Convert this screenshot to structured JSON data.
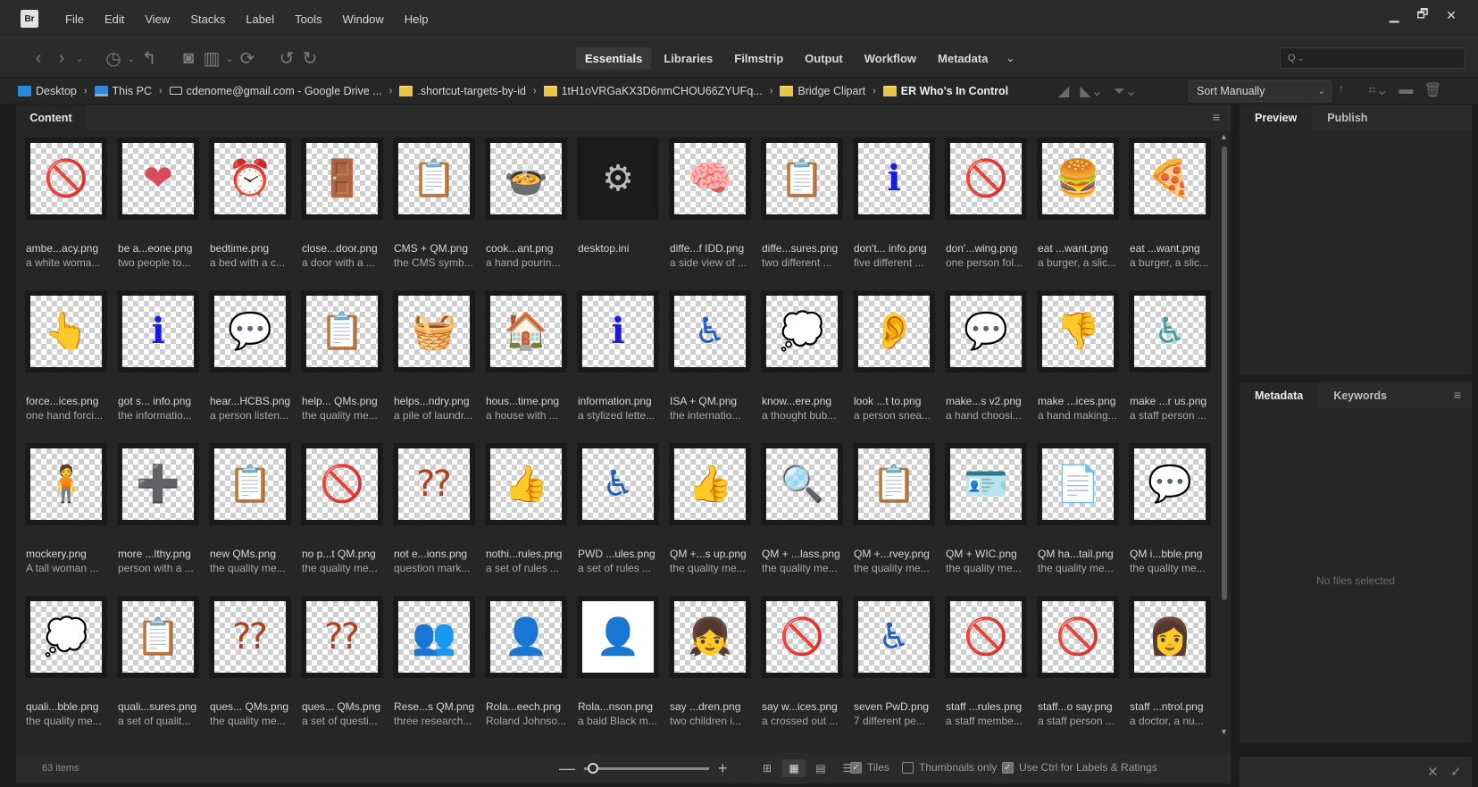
{
  "app": {
    "logo": "Br"
  },
  "menu": [
    "File",
    "Edit",
    "View",
    "Stacks",
    "Label",
    "Tools",
    "Window",
    "Help"
  ],
  "window_controls": {
    "minimize": "▁",
    "restore": "🗗",
    "close": "✕"
  },
  "workspaces": [
    {
      "label": "Essentials",
      "active": true
    },
    {
      "label": "Libraries",
      "active": false
    },
    {
      "label": "Filmstrip",
      "active": false
    },
    {
      "label": "Output",
      "active": false
    },
    {
      "label": "Workflow",
      "active": false
    },
    {
      "label": "Metadata",
      "active": false
    }
  ],
  "search": {
    "placeholder": "Q"
  },
  "breadcrumbs": [
    {
      "label": "Desktop",
      "icon": "desktop-icon"
    },
    {
      "label": "This PC",
      "icon": "computer-icon"
    },
    {
      "label": "cdenome@gmail.com - Google Drive ...",
      "icon": "drive-icon"
    },
    {
      "label": ".shortcut-targets-by-id",
      "icon": "folder-icon"
    },
    {
      "label": "1tH1oVRGaKX3D6nmCHOU66ZYUFq...",
      "icon": "folder-icon"
    },
    {
      "label": "Bridge Clipart",
      "icon": "folder-icon"
    },
    {
      "label": "ER Who's In Control",
      "icon": "folder-icon"
    }
  ],
  "sort": {
    "label": "Sort Manually"
  },
  "content_panel": {
    "tab": "Content",
    "item_count": "63 items"
  },
  "files": [
    {
      "name": "ambe...acy.png",
      "desc": "a white woma...",
      "glyph": "🚫",
      "color": "#e0303a"
    },
    {
      "name": "be a...eone.png",
      "desc": "two people to...",
      "glyph": "❤",
      "color": "#d94a5a"
    },
    {
      "name": "bedtime.png",
      "desc": "a bed with a c...",
      "glyph": "⏰",
      "color": "#7a4aa0"
    },
    {
      "name": "close...door.png",
      "desc": "a door with a ...",
      "glyph": "🚪",
      "color": "#7aa0c0"
    },
    {
      "name": "CMS + QM.png",
      "desc": "the CMS symb...",
      "glyph": "📋",
      "color": "#333"
    },
    {
      "name": "cook...ant.png",
      "desc": "a hand pourin...",
      "glyph": "🍲",
      "color": "#c0392b"
    },
    {
      "name": "desktop.ini",
      "desc": "",
      "glyph": "⚙",
      "color": "#bbb",
      "kind": "doc"
    },
    {
      "name": "diffe...f IDD.png",
      "desc": "a side view of ...",
      "glyph": "🧠",
      "color": "#e8a0b0"
    },
    {
      "name": "diffe...sures.png",
      "desc": "two different ...",
      "glyph": "📋",
      "color": "#333"
    },
    {
      "name": "don't... info.png",
      "desc": "five different ...",
      "glyph": "ℹ",
      "color": "#1a1ae0"
    },
    {
      "name": "don'...wing.png",
      "desc": "one person fol...",
      "glyph": "🚫",
      "color": "#e0303a"
    },
    {
      "name": "eat ...want.png",
      "desc": "a burger, a slic...",
      "glyph": "🍔",
      "color": "#c07a30"
    },
    {
      "name": "eat ...want.png",
      "desc": "a burger, a slic...",
      "glyph": "🍕",
      "color": "#c07a30"
    },
    {
      "name": "force...ices.png",
      "desc": "one hand forci...",
      "glyph": "👆",
      "color": "#b07a50"
    },
    {
      "name": "got s... info.png",
      "desc": "the informatio...",
      "glyph": "ℹ",
      "color": "#1a1ae0"
    },
    {
      "name": "hear...HCBS.png",
      "desc": "a person listen...",
      "glyph": "💬",
      "color": "#333"
    },
    {
      "name": "help... QMs.png",
      "desc": "the quality me...",
      "glyph": "📋",
      "color": "#e03030"
    },
    {
      "name": "helps...ndry.png",
      "desc": "a pile of laundr...",
      "glyph": "🧺",
      "color": "#40b0d0"
    },
    {
      "name": "hous...time.png",
      "desc": "a house with ...",
      "glyph": "🏠",
      "color": "#d0a030"
    },
    {
      "name": "information.png",
      "desc": "a stylized lette...",
      "glyph": "ℹ",
      "color": "#1a1ae0"
    },
    {
      "name": "ISA + QM.png",
      "desc": "the internatio...",
      "glyph": "♿",
      "color": "#2060c0"
    },
    {
      "name": "know...ere.png",
      "desc": "a thought bub...",
      "glyph": "💭",
      "color": "#3070c0"
    },
    {
      "name": "look ...t to.png",
      "desc": "a person snea...",
      "glyph": "👂",
      "color": "#30a040"
    },
    {
      "name": "make...s v2.png",
      "desc": "a hand choosi...",
      "glyph": "💬",
      "color": "#c05050"
    },
    {
      "name": "make ...ices.png",
      "desc": "a hand making...",
      "glyph": "👎",
      "color": "#e03030"
    },
    {
      "name": "make ...r us.png",
      "desc": "a staff person ...",
      "glyph": "♿",
      "color": "#40a0a0"
    },
    {
      "name": "mockery.png",
      "desc": "A tall woman ...",
      "glyph": "🧍",
      "color": "#8040a0"
    },
    {
      "name": "more ...lthy.png",
      "desc": "person with a ...",
      "glyph": "➕",
      "color": "#30a040"
    },
    {
      "name": "new QMs.png",
      "desc": "the quality me...",
      "glyph": "📋",
      "color": "#e0a020"
    },
    {
      "name": "no p...t QM.png",
      "desc": "the quality me...",
      "glyph": "🚫",
      "color": "#e0303a"
    },
    {
      "name": "not e...ions.png",
      "desc": "question mark...",
      "glyph": "⁇",
      "color": "#b04020"
    },
    {
      "name": "nothi...rules.png",
      "desc": "a set of rules ...",
      "glyph": "👍",
      "color": "#40a040"
    },
    {
      "name": "PWD ...ules.png",
      "desc": "a set of rules ...",
      "glyph": "♿",
      "color": "#2060c0"
    },
    {
      "name": "QM +...s up.png",
      "desc": "the quality me...",
      "glyph": "👍",
      "color": "#40a040"
    },
    {
      "name": "QM + ...lass.png",
      "desc": "the quality me...",
      "glyph": "🔍",
      "color": "#e0a020"
    },
    {
      "name": "QM +...rvey.png",
      "desc": "the quality me...",
      "glyph": "📋",
      "color": "#c09050"
    },
    {
      "name": "QM + WIC.png",
      "desc": "the quality me...",
      "glyph": "🪪",
      "color": "#333"
    },
    {
      "name": "QM ha...tail.png",
      "desc": "the quality me...",
      "glyph": "📄",
      "color": "#c05060"
    },
    {
      "name": "QM i...bble.png",
      "desc": "the quality me...",
      "glyph": "💬",
      "color": "#333"
    },
    {
      "name": "quali...bble.png",
      "desc": "the quality me...",
      "glyph": "💭",
      "color": "#333"
    },
    {
      "name": "quali...sures.png",
      "desc": "a set of qualit...",
      "glyph": "📋",
      "color": "#333"
    },
    {
      "name": "ques... QMs.png",
      "desc": "the quality me...",
      "glyph": "⁇",
      "color": "#b04020"
    },
    {
      "name": "ques... QMs.png",
      "desc": "a set of questi...",
      "glyph": "⁇",
      "color": "#b04020"
    },
    {
      "name": "Rese...s QM.png",
      "desc": "three research...",
      "glyph": "👥",
      "color": "#4060a0"
    },
    {
      "name": "Rola...eech.png",
      "desc": "Roland Johnso...",
      "glyph": "👤",
      "color": "#5a3a2a"
    },
    {
      "name": "Rola...nson.png",
      "desc": "a bald Black m...",
      "glyph": "👤",
      "color": "#3a2a1a",
      "kind": "plain"
    },
    {
      "name": "say ...dren.png",
      "desc": "two children i...",
      "glyph": "👧",
      "color": "#d08060"
    },
    {
      "name": "say w...ices.png",
      "desc": "a crossed out ...",
      "glyph": "🚫",
      "color": "#e0303a"
    },
    {
      "name": "seven PwD.png",
      "desc": "7 different pe...",
      "glyph": "♿",
      "color": "#2060c0"
    },
    {
      "name": "staff ...rules.png",
      "desc": "a staff membe...",
      "glyph": "🚫",
      "color": "#111"
    },
    {
      "name": "staff...o say.png",
      "desc": "a staff person ...",
      "glyph": "🚫",
      "color": "#111"
    },
    {
      "name": "staff ...ntrol.png",
      "desc": "a doctor, a nu...",
      "glyph": "👩",
      "color": "#40a0a0"
    }
  ],
  "statusbar": {
    "minus": "—",
    "plus": "+",
    "tiles": "Tiles",
    "thumbnails_only": "Thumbnails only",
    "ctrl_labels": "Use Ctrl for Labels & Ratings"
  },
  "preview_panel": {
    "tabs": [
      "Preview",
      "Publish"
    ]
  },
  "metadata_panel": {
    "tabs": [
      "Metadata",
      "Keywords"
    ],
    "empty_text": "No files selected"
  }
}
